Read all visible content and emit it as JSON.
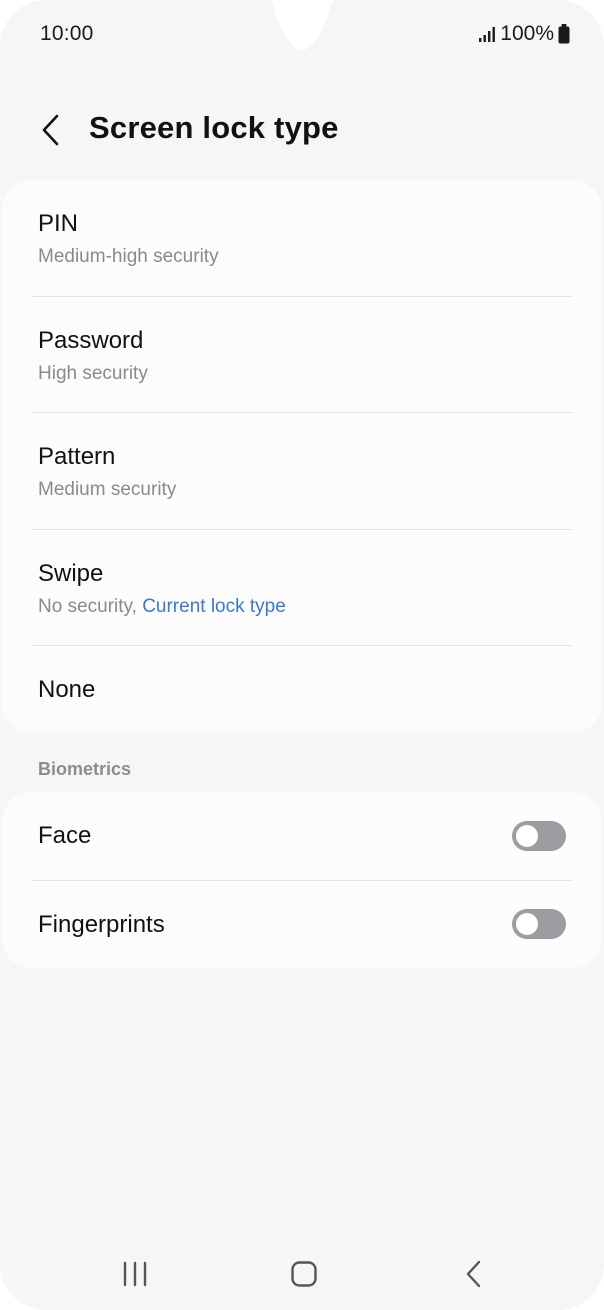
{
  "status_bar": {
    "time": "10:00",
    "battery": "100%"
  },
  "header": {
    "title": "Screen lock type"
  },
  "lock_types": [
    {
      "title": "PIN",
      "subtitle": "Medium-high security"
    },
    {
      "title": "Password",
      "subtitle": "High security"
    },
    {
      "title": "Pattern",
      "subtitle": "Medium security"
    },
    {
      "title": "Swipe",
      "subtitle": "No security, ",
      "current_label": "Current lock type"
    },
    {
      "title": "None"
    }
  ],
  "biometrics": {
    "section_label": "Biometrics",
    "items": [
      {
        "title": "Face",
        "enabled": false
      },
      {
        "title": "Fingerprints",
        "enabled": false
      }
    ]
  },
  "colors": {
    "accent": "#3a79c8",
    "background": "#f6f6f8",
    "card": "#fcfcfd",
    "toggle_off": "#9c9ca1"
  },
  "icons": {
    "back": "chevron-left-icon",
    "signal": "signal-icon",
    "battery": "battery-icon",
    "recents": "recents-icon",
    "home": "home-icon",
    "nav_back": "back-icon"
  }
}
